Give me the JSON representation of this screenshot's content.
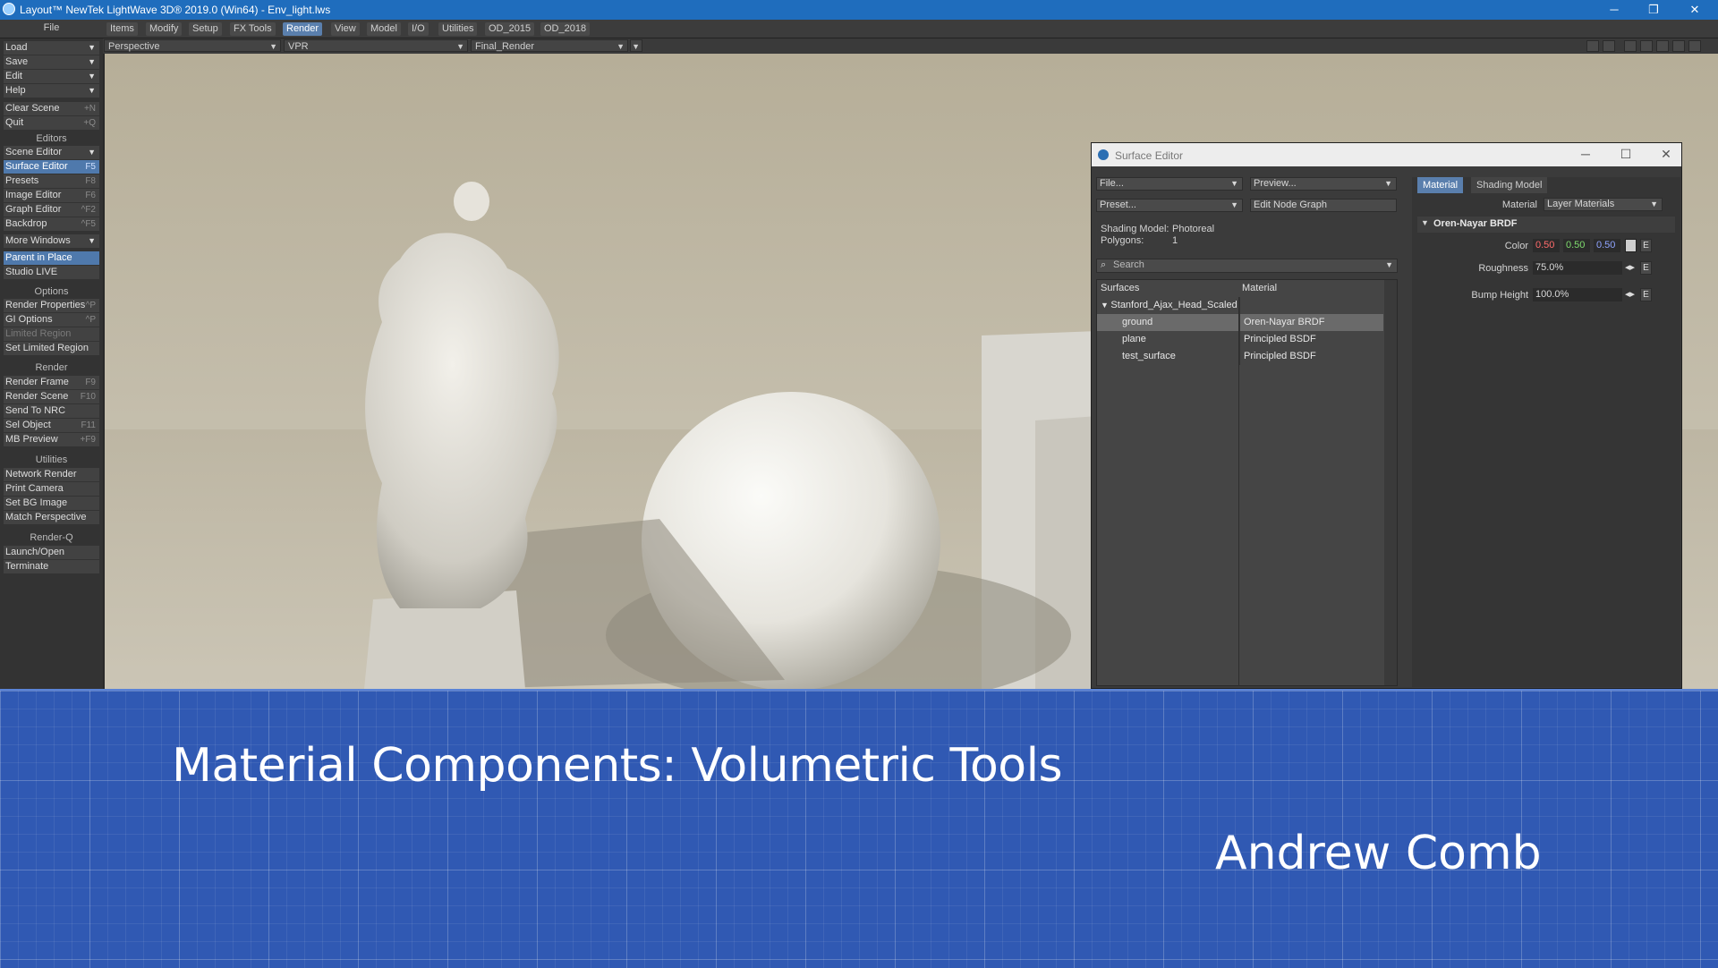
{
  "window": {
    "title": "Layout™ NewTek LightWave 3D® 2019.0 (Win64) - Env_light.lws",
    "minimize": "─",
    "restore": "❐",
    "close": "✕"
  },
  "menubar": {
    "file_label": "File",
    "tabs": [
      "Items",
      "Modify",
      "Setup",
      "FX Tools",
      "Render",
      "View",
      "Model",
      "I/O",
      "Utilities",
      "OD_2015",
      "OD_2018"
    ],
    "active_tab": "Render"
  },
  "viewport_bar": {
    "view_mode": "Perspective",
    "render_mode": "VPR",
    "camera": "Final_Render"
  },
  "left_toolbar": {
    "file_section": [
      {
        "label": "Load",
        "dropdown": true
      },
      {
        "label": "Save",
        "dropdown": true
      },
      {
        "label": "Edit",
        "dropdown": true
      },
      {
        "label": "Help",
        "dropdown": true
      },
      {
        "label": "Clear Scene",
        "shortcut": "+N"
      },
      {
        "label": "Quit",
        "shortcut": "+Q"
      }
    ],
    "editors_header": "Editors",
    "editors": [
      {
        "label": "Scene Editor",
        "dropdown": true
      },
      {
        "label": "Surface Editor",
        "shortcut": "F5",
        "active": true
      },
      {
        "label": "Presets",
        "shortcut": "F8"
      },
      {
        "label": "Image Editor",
        "shortcut": "F6"
      },
      {
        "label": "Graph Editor",
        "shortcut": "^F2"
      },
      {
        "label": "Backdrop",
        "shortcut": "^F5"
      },
      {
        "label": "More Windows",
        "dropdown": true
      },
      {
        "label": "Parent in Place",
        "active": true
      },
      {
        "label": "Studio LIVE"
      }
    ],
    "options_header": "Options",
    "options": [
      {
        "label": "Render Properties",
        "shortcut": "^P"
      },
      {
        "label": "GI Options",
        "shortcut": "^P"
      },
      {
        "label": "Limited Region",
        "disabled": true
      },
      {
        "label": "Set Limited Region"
      }
    ],
    "render_header": "Render",
    "render": [
      {
        "label": "Render Frame",
        "shortcut": "F9"
      },
      {
        "label": "Render Scene",
        "shortcut": "F10"
      },
      {
        "label": "Send To NRC"
      },
      {
        "label": "Sel Object",
        "shortcut": "F11"
      },
      {
        "label": "MB Preview",
        "shortcut": "+F9"
      }
    ],
    "utilities_header": "Utilities",
    "utilities": [
      {
        "label": "Network Render"
      },
      {
        "label": "Print Camera"
      },
      {
        "label": "Set BG Image"
      },
      {
        "label": "Match Perspective"
      }
    ],
    "renderq_header": "Render-Q",
    "renderq": [
      {
        "label": "Launch/Open"
      },
      {
        "label": "Terminate"
      }
    ]
  },
  "surface_editor": {
    "title": "Surface Editor",
    "file_btn": "File...",
    "preview_btn": "Preview...",
    "preset_btn": "Preset...",
    "edit_node_graph": "Edit Node Graph",
    "shading_model_label": "Shading Model:",
    "shading_model_value": "Photoreal",
    "polygons_label": "Polygons:",
    "polygons_value": "1",
    "search_placeholder": "Search",
    "col_surfaces": "Surfaces",
    "col_material": "Material",
    "object_name": "Stanford_Ajax_Head_Scaled",
    "surfaces": [
      {
        "name": "ground",
        "material": "Oren-Nayar BRDF",
        "selected": true
      },
      {
        "name": "plane",
        "material": "Principled BSDF"
      },
      {
        "name": "test_surface",
        "material": "Principled BSDF"
      }
    ],
    "tabs": [
      "Material",
      "Shading Model"
    ],
    "active_tab": "Material",
    "material_label": "Material",
    "material_value": "Layer Materials",
    "brdf_header": "Oren-Nayar BRDF",
    "color_label": "Color",
    "color_r": "0.50",
    "color_g": "0.50",
    "color_b": "0.50",
    "roughness_label": "Roughness",
    "roughness_value": "75.0%",
    "bump_label": "Bump Height",
    "bump_value": "100.0%",
    "envelope_label": "E"
  },
  "banner": {
    "heading": "Material Components: Volumetric Tools",
    "author": "Andrew Comb"
  },
  "colors": {
    "titlebar": "#1f6dbd",
    "accent": "#5a7fad",
    "banner": "#3059b3"
  }
}
